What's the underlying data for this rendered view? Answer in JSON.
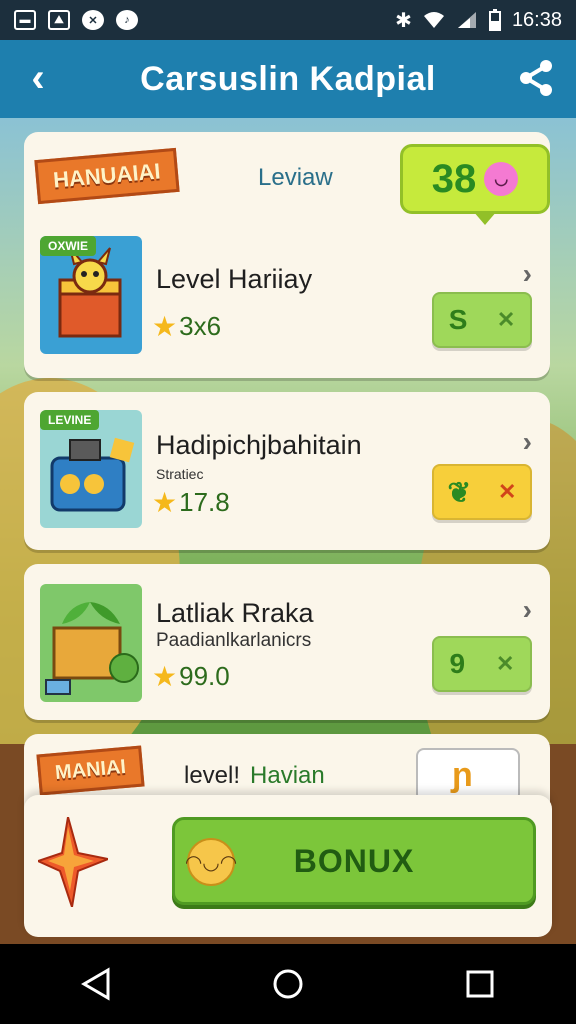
{
  "status_bar": {
    "time": "16:38"
  },
  "header": {
    "title": "Carsuslin Kadpial"
  },
  "featured": {
    "banner": "HANUAIAI",
    "label": "Leviaw",
    "score": "38"
  },
  "items": [
    {
      "tag": "OXWIE",
      "title": "Level Hariiay",
      "subtitle": "",
      "rating": "3x6",
      "action": "S"
    },
    {
      "tag": "LEVINE",
      "title": "Hadipichjbahitain",
      "subtitle": "Stratiec",
      "rating": "17.8",
      "action": ""
    },
    {
      "tag": "",
      "title": "Latliak Rraka",
      "subtitle": "Paadianlkarlanicrs",
      "rating": "99.0",
      "action": "9"
    }
  ],
  "bottom_card": {
    "banner": "MANIAI",
    "label_prefix": "level!",
    "label": "Havian"
  },
  "bonus": {
    "label": "BONUX"
  },
  "colors": {
    "header": "#1e7fae",
    "accent_green": "#7cc63a",
    "banner_orange": "#e9782a"
  }
}
